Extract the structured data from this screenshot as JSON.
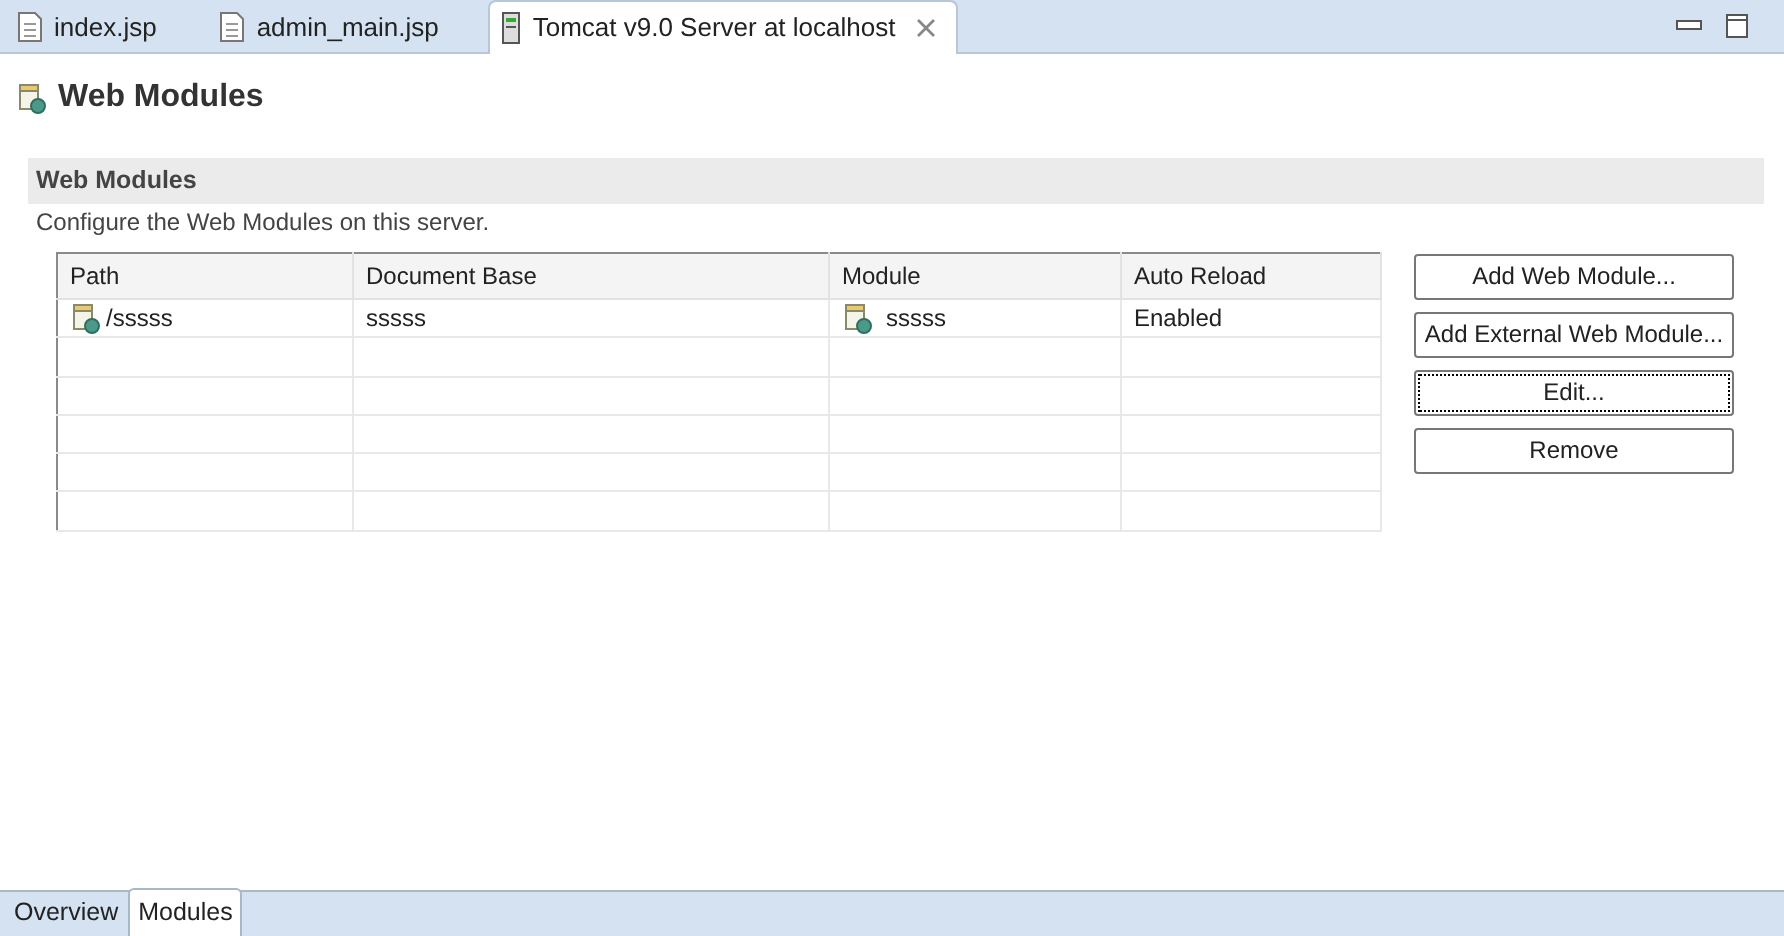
{
  "editor_tabs": [
    {
      "label": "index.jsp",
      "kind": "file",
      "selected": false
    },
    {
      "label": "admin_main.jsp",
      "kind": "file",
      "selected": false
    },
    {
      "label": "Tomcat v9.0 Server at localhost",
      "kind": "server",
      "selected": true
    }
  ],
  "page_title": "Web Modules",
  "section": {
    "title": "Web Modules",
    "description": "Configure the Web Modules on this server."
  },
  "table": {
    "columns": [
      "Path",
      "Document Base",
      "Module",
      "Auto Reload"
    ],
    "rows": [
      {
        "path": "/sssss",
        "document_base": "sssss",
        "module": "sssss",
        "auto_reload": "Enabled"
      }
    ]
  },
  "buttons": [
    {
      "label": "Add Web Module...",
      "focused": false
    },
    {
      "label": "Add External Web Module...",
      "focused": false
    },
    {
      "label": "Edit...",
      "focused": true
    },
    {
      "label": "Remove",
      "focused": false
    }
  ],
  "bottom_tabs": [
    {
      "label": "Overview",
      "selected": false
    },
    {
      "label": "Modules",
      "selected": true
    }
  ]
}
